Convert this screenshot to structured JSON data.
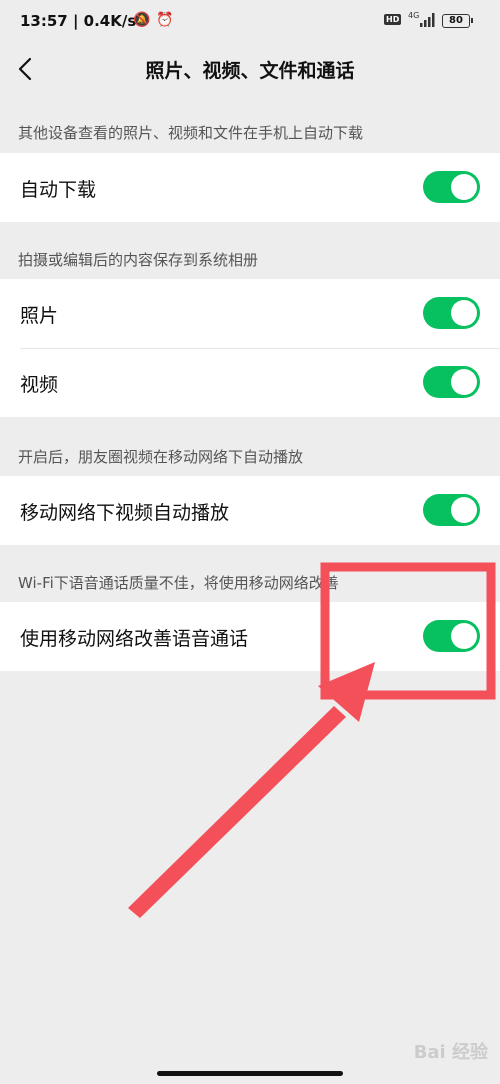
{
  "status_bar": {
    "time": "13:57 | 0.4K/s",
    "hd": "HD",
    "network": "4G",
    "battery": "80",
    "icons": [
      "mute-icon",
      "alarm-icon",
      "signal-icon",
      "battery-icon"
    ]
  },
  "header": {
    "title": "照片、视频、文件和通话",
    "back_icon": "back-arrow-icon"
  },
  "sections": [
    {
      "label": "其他设备查看的照片、视频和文件在手机上自动下载",
      "items": [
        {
          "label": "自动下载",
          "on": true
        }
      ]
    },
    {
      "label": "拍摄或编辑后的内容保存到系统相册",
      "items": [
        {
          "label": "照片",
          "on": true
        },
        {
          "label": "视频",
          "on": true
        }
      ]
    },
    {
      "label": "开启后，朋友圈视频在移动网络下自动播放",
      "items": [
        {
          "label": "移动网络下视频自动播放",
          "on": true
        }
      ]
    },
    {
      "label": "Wi-Fi下语音通话质量不佳，将使用移动网络改善",
      "items": [
        {
          "label": "使用移动网络改善语音通话",
          "on": true
        }
      ]
    }
  ],
  "colors": {
    "background": "#ededed",
    "toggle_on": "#07c160",
    "annotation": "#f4505a"
  },
  "watermark": "Bai 经验"
}
